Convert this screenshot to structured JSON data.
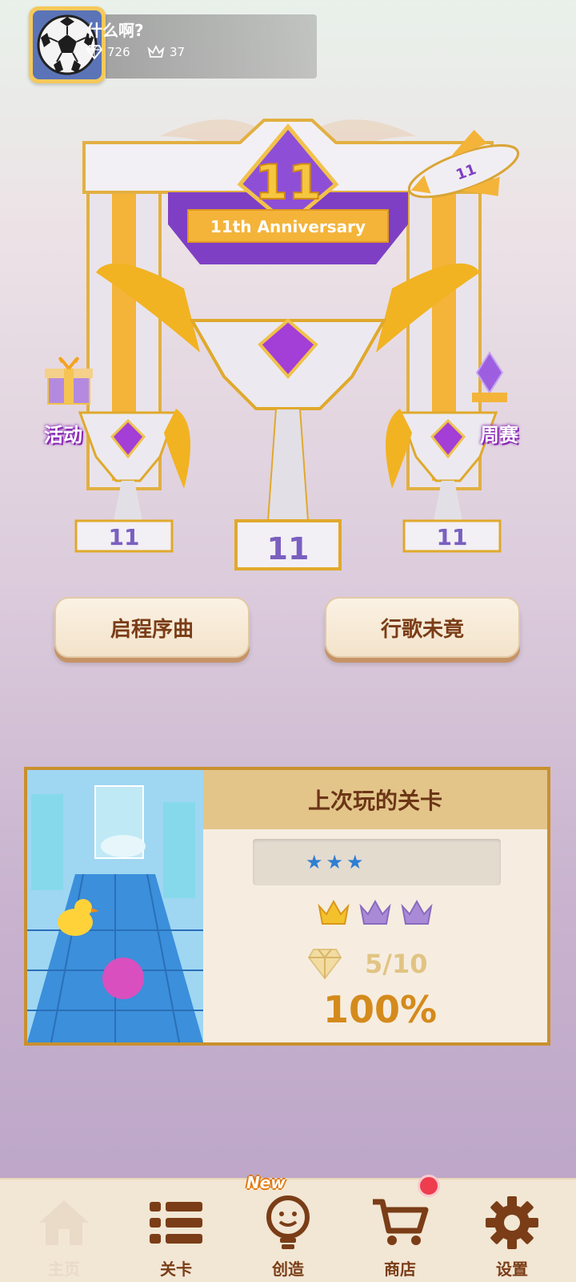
{
  "profile": {
    "name": "什么啊?",
    "gems": "726",
    "crowns": "37",
    "avatar_icon": "soccer-ball-icon"
  },
  "hero": {
    "anniversary_number": "11",
    "anniversary_banner": "11th Anniversary",
    "trophy_number": "11",
    "left_trophy_number": "11",
    "right_trophy_number": "11",
    "left_label": "活动",
    "right_label": "周赛"
  },
  "buttons": {
    "left": "启程序曲",
    "right": "行歌未竟"
  },
  "last_played": {
    "title": "上次玩的关卡",
    "stars": "★★★",
    "crowns_earned": 1,
    "crowns_total": 3,
    "gems": "5/10",
    "percent": "100%"
  },
  "nav": {
    "items": [
      {
        "label": "主页",
        "icon": "home-icon",
        "active": true
      },
      {
        "label": "关卡",
        "icon": "list-icon"
      },
      {
        "label": "创造",
        "icon": "lightbulb-icon",
        "badge": "New"
      },
      {
        "label": "商店",
        "icon": "cart-icon",
        "dot": true
      },
      {
        "label": "设置",
        "icon": "gear-icon"
      }
    ]
  },
  "colors": {
    "accent_gold": "#f0b429",
    "accent_purple": "#9b4fd6",
    "brown_text": "#7a3d17",
    "card_border": "#c9902e",
    "percent": "#d48a1c"
  }
}
